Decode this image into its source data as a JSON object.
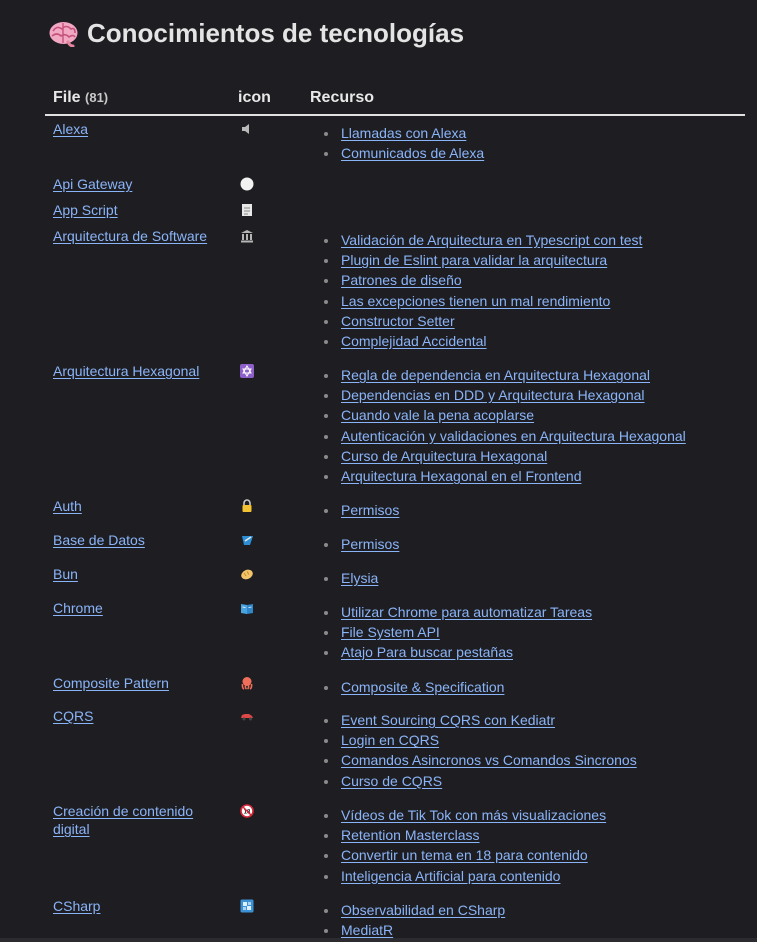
{
  "heading": {
    "emoji_icon": "brain-icon",
    "title": "Conocimientos de tecnologías"
  },
  "table": {
    "headers": {
      "file": "File",
      "file_count": "(81)",
      "icon": "icon",
      "recurso": "Recurso"
    },
    "rows": [
      {
        "file": "Alexa",
        "icon": "speaker-icon",
        "resources": [
          "Llamadas con Alexa",
          "Comunicados de Alexa"
        ]
      },
      {
        "file": "Api Gateway",
        "icon": "white-circle-icon",
        "resources": []
      },
      {
        "file": "App Script",
        "icon": "page-icon",
        "resources": []
      },
      {
        "file": "Arquitectura de Software",
        "icon": "classical-building-icon",
        "resources": [
          "Validación de Arquitectura en Typescript con test",
          "Plugin de Eslint para validar la arquitectura",
          "Patrones de diseño",
          "Las excepciones tienen un mal rendimiento",
          "Constructor Setter",
          "Complejidad Accidental"
        ]
      },
      {
        "file": "Arquitectura Hexagonal",
        "icon": "six-pointed-star-icon",
        "resources": [
          "Regla de dependencia en Arquitectura Hexagonal",
          "Dependencias en DDD y Arquitectura Hexagonal",
          "Cuando vale la pena acoplarse",
          "Autenticación y validaciones en Arquitectura Hexagonal",
          "Curso de Arquitectura Hexagonal",
          "Arquitectura Hexagonal en el Frontend"
        ]
      },
      {
        "file": "Auth",
        "icon": "lock-icon",
        "resources": [
          "Permisos"
        ]
      },
      {
        "file": "Base de Datos",
        "icon": "flask-icon",
        "resources": [
          "Permisos"
        ]
      },
      {
        "file": "Bun",
        "icon": "bread-icon",
        "resources": [
          "Elysia"
        ]
      },
      {
        "file": "Chrome",
        "icon": "open-book-icon",
        "resources": [
          "Utilizar Chrome para automatizar Tareas",
          "File System API",
          "Atajo Para buscar pestañas"
        ]
      },
      {
        "file": "Composite Pattern",
        "icon": "octopus-icon",
        "resources": [
          "Composite & Specification"
        ]
      },
      {
        "file": "CQRS",
        "icon": "car-icon",
        "resources": [
          "Event Sourcing CQRS con Kediatr",
          "Login en CQRS",
          "Comandos Asincronos vs Comandos Sincronos",
          "Curso de CQRS"
        ]
      },
      {
        "file": "Creación de contenido digital",
        "icon": "no-under-eighteen-icon",
        "resources": [
          "Vídeos de Tik Tok con más visualizaciones",
          "Retention Masterclass",
          "Convertir un tema en 18 para contenido",
          "Inteligencia Artificial para contenido"
        ]
      },
      {
        "file": "CSharp",
        "icon": "window-icon",
        "resources": [
          "Observabilidad en CSharp",
          "MediatR"
        ]
      }
    ]
  },
  "colors": {
    "background": "#1e1e22",
    "link": "#8ab4f8",
    "text": "#dadada",
    "header_rule": "#e0e0e0"
  }
}
